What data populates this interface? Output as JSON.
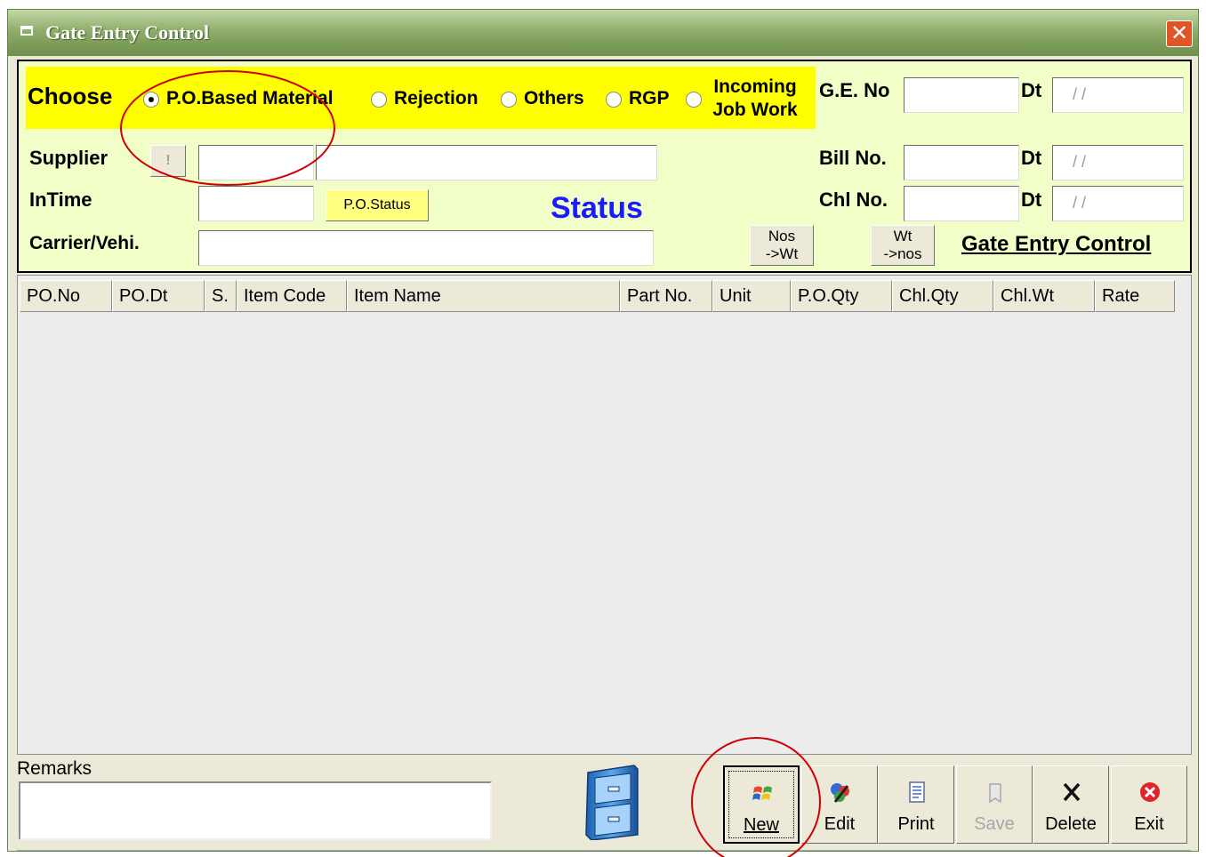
{
  "window": {
    "title": "Gate Entry Control",
    "close_glyph": "✕"
  },
  "choose": {
    "label": "Choose",
    "options": [
      {
        "label": "P.O.Based Material",
        "checked": true
      },
      {
        "label": "Rejection",
        "checked": false
      },
      {
        "label": "Others",
        "checked": false
      },
      {
        "label": "RGP",
        "checked": false
      },
      {
        "label": "Incoming Job Work",
        "checked": false
      }
    ]
  },
  "fields": {
    "supplier": "Supplier",
    "supplier_lookup": "!",
    "intime": "InTime",
    "po_status_btn": "P.O.Status",
    "status": "Status",
    "carrier": "Carrier/Vehi.",
    "ge_no": "G.E. No",
    "bill_no": "Bill No.",
    "chl_no": "Chl No.",
    "dt": "Dt",
    "date_placeholder": "/ /",
    "nos_wt_1": "Nos",
    "nos_wt_2": "->Wt",
    "wt_nos_1": "Wt",
    "wt_nos_2": "->nos",
    "gate_link": "Gate Entry Control"
  },
  "grid": {
    "columns": [
      "PO.No",
      "PO.Dt",
      "S.",
      "Item Code",
      "Item Name",
      "Part No.",
      "Unit",
      "P.O.Qty",
      "Chl.Qty",
      "Chl.Wt",
      "Rate"
    ]
  },
  "remarks": {
    "label": "Remarks"
  },
  "toolbar": {
    "new": "New",
    "edit": "Edit",
    "print": "Print",
    "save": "Save",
    "delete": "Delete",
    "exit": "Exit"
  },
  "colors": {
    "panel": "#f2fec8",
    "choose_bar": "#ffff00",
    "status": "#1a1aff",
    "annotation": "#d00000"
  }
}
